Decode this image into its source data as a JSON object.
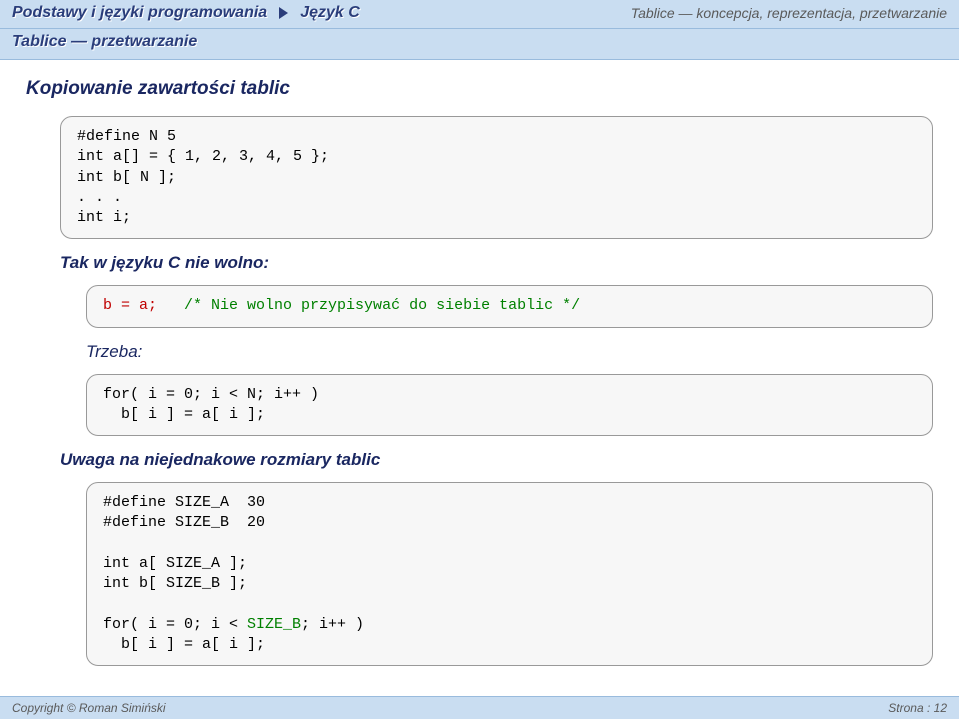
{
  "header": {
    "crumb1": "Podstawy i języki programowania",
    "crumb2": "Język C",
    "topic": "Tablice — koncepcja, reprezentacja, przetwarzanie"
  },
  "subheader": "Tablice — przetwarzanie",
  "title": "Kopiowanie zawartości tablic",
  "code1": {
    "l1": "#define N 5",
    "l2": "int a[] = { 1, 2, 3, 4, 5 };",
    "l3": "int b[ N ];",
    "l4": ". . .",
    "l5": "int i;"
  },
  "sub1": "Tak w języku C nie wolno:",
  "code2": {
    "red": "b = a;",
    "green": "/* Nie wolno przypisywać do siebie tablic */"
  },
  "sub2": "Trzeba:",
  "code3": {
    "l1": "for( i = 0; i < N; i++ )",
    "l2": "  b[ i ] = a[ i ];"
  },
  "sub3": "Uwaga na niejednakowe rozmiary tablic",
  "code4": {
    "l1": "#define SIZE_A  30",
    "l2": "#define SIZE_B  20",
    "l3": "",
    "l4": "int a[ SIZE_A ];",
    "l5": "int b[ SIZE_B ];",
    "l6": "",
    "l7a": "for( i = 0; i < ",
    "l7b": "SIZE_B",
    "l7c": "; i++ )",
    "l8": "  b[ i ] = a[ i ];"
  },
  "footer": {
    "left": "Copyright © Roman Simiński",
    "right": "Strona : 12"
  }
}
